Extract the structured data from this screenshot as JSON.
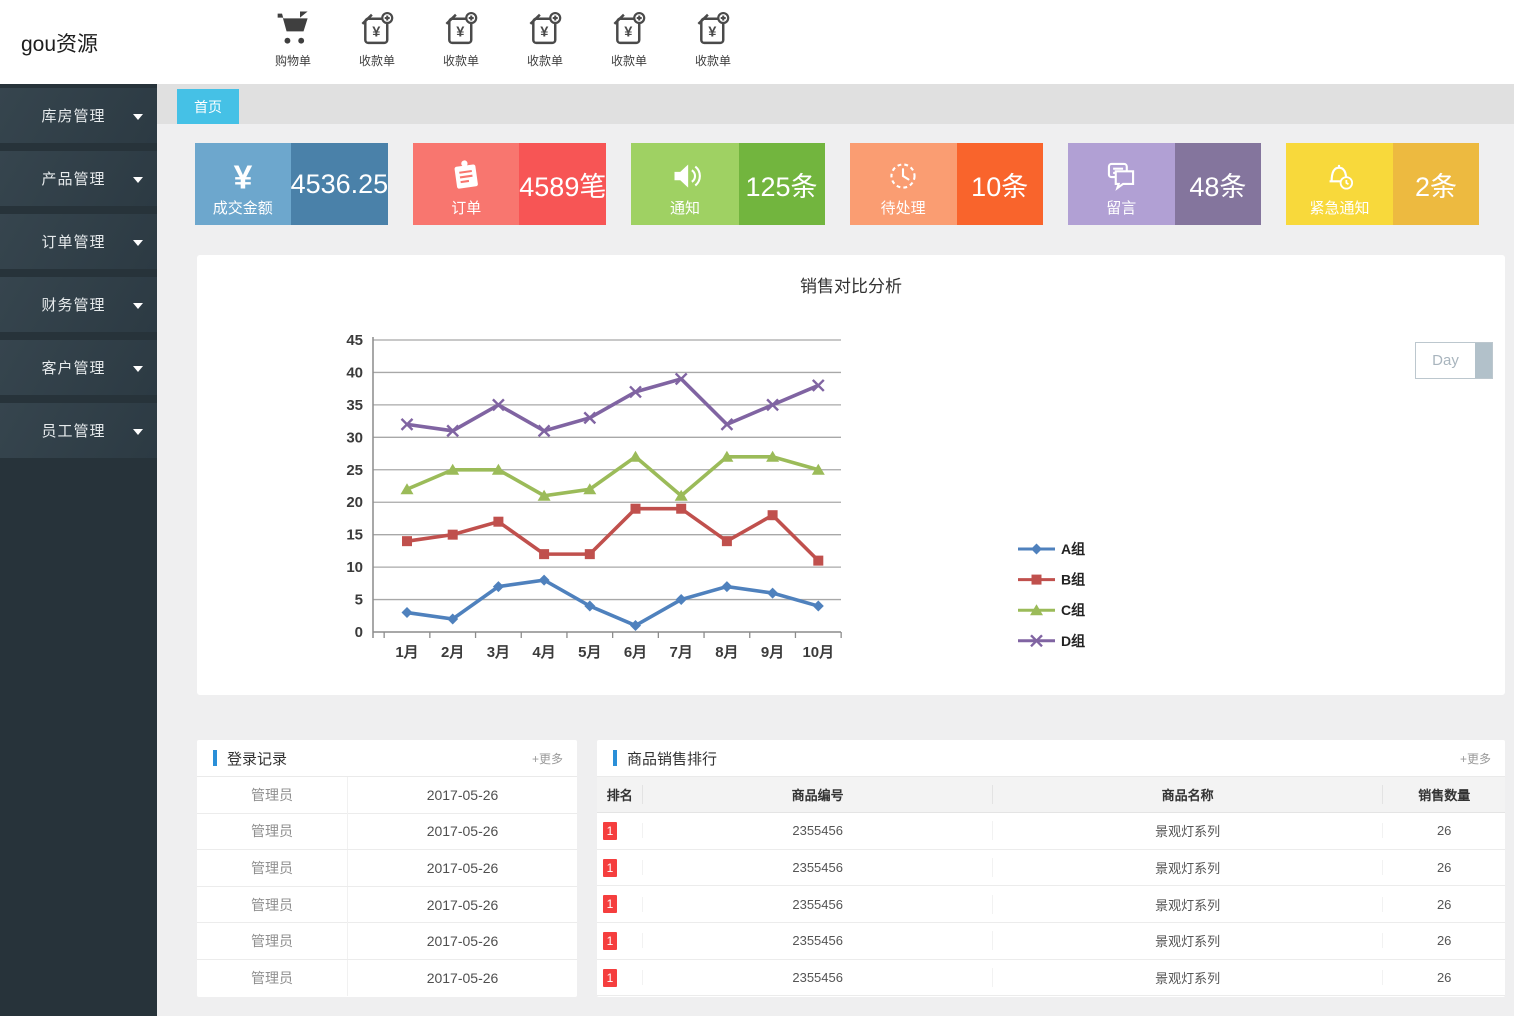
{
  "brand": "gou资源",
  "header": {
    "actions": [
      {
        "label": "购物单",
        "icon": "cart-icon"
      },
      {
        "label": "收款单",
        "icon": "receipt-add-icon"
      },
      {
        "label": "收款单",
        "icon": "receipt-add-icon"
      },
      {
        "label": "收款单",
        "icon": "receipt-add-icon"
      },
      {
        "label": "收款单",
        "icon": "receipt-add-icon"
      },
      {
        "label": "收款单",
        "icon": "receipt-add-icon"
      }
    ]
  },
  "sidebar": {
    "items": [
      {
        "label": "库房管理"
      },
      {
        "label": "产品管理"
      },
      {
        "label": "订单管理"
      },
      {
        "label": "财务管理"
      },
      {
        "label": "客户管理"
      },
      {
        "label": "员工管理"
      }
    ]
  },
  "tabs": {
    "home": "首页"
  },
  "stats": [
    {
      "label": "成交金额",
      "value": "4536.25",
      "icon": "yen-icon",
      "light": "#6da7cd",
      "dark": "#4a81a9"
    },
    {
      "label": "订单",
      "value": "4589笔",
      "icon": "order-icon",
      "light": "#f8766f",
      "dark": "#f75555"
    },
    {
      "label": "通知",
      "value": "125条",
      "icon": "speaker-icon",
      "light": "#9fd163",
      "dark": "#72b53e"
    },
    {
      "label": "待处理",
      "value": "10条",
      "icon": "clock-icon",
      "light": "#fa9d72",
      "dark": "#f9642c"
    },
    {
      "label": "留言",
      "value": "48条",
      "icon": "chat-icon",
      "light": "#b1a0d4",
      "dark": "#84759d"
    },
    {
      "label": "紧急通知",
      "value": "2条",
      "icon": "alarm-icon",
      "light": "#f8d93b",
      "dark": "#edba40"
    }
  ],
  "chart_data": {
    "type": "line",
    "title": "销售对比分析",
    "range_button": "Day",
    "categories": [
      "1月",
      "2月",
      "3月",
      "4月",
      "5月",
      "6月",
      "7月",
      "8月",
      "9月",
      "10月"
    ],
    "series": [
      {
        "name": "A组",
        "marker": "diamond",
        "color": "#4F81BD",
        "values": [
          3,
          2,
          7,
          8,
          4,
          1,
          5,
          7,
          6,
          4
        ]
      },
      {
        "name": "B组",
        "marker": "square",
        "color": "#C0504D",
        "values": [
          14,
          15,
          17,
          12,
          12,
          19,
          19,
          14,
          18,
          11
        ]
      },
      {
        "name": "C组",
        "marker": "triangle",
        "color": "#9BBB59",
        "values": [
          22,
          25,
          25,
          21,
          22,
          27,
          21,
          27,
          27,
          25
        ]
      },
      {
        "name": "D组",
        "marker": "x",
        "color": "#8064A2",
        "values": [
          32,
          31,
          35,
          31,
          33,
          37,
          39,
          32,
          35,
          38
        ]
      }
    ],
    "ylim": [
      0,
      45
    ],
    "ytick": 5,
    "grid": true,
    "legend_position": "right"
  },
  "login_panel": {
    "title": "登录记录",
    "more": "+更多",
    "rows": [
      {
        "user": "管理员",
        "date": "2017-05-26"
      },
      {
        "user": "管理员",
        "date": "2017-05-26"
      },
      {
        "user": "管理员",
        "date": "2017-05-26"
      },
      {
        "user": "管理员",
        "date": "2017-05-26"
      },
      {
        "user": "管理员",
        "date": "2017-05-26"
      },
      {
        "user": "管理员",
        "date": "2017-05-26"
      }
    ]
  },
  "sales_panel": {
    "title": "商品销售排行",
    "more": "+更多",
    "columns": [
      "排名",
      "商品编号",
      "商品名称",
      "销售数量"
    ],
    "rows": [
      {
        "rank": "1",
        "code": "2355456",
        "name": "景观灯系列",
        "qty": "26"
      },
      {
        "rank": "1",
        "code": "2355456",
        "name": "景观灯系列",
        "qty": "26"
      },
      {
        "rank": "1",
        "code": "2355456",
        "name": "景观灯系列",
        "qty": "26"
      },
      {
        "rank": "1",
        "code": "2355456",
        "name": "景观灯系列",
        "qty": "26"
      },
      {
        "rank": "1",
        "code": "2355456",
        "name": "景观灯系列",
        "qty": "26"
      }
    ]
  }
}
